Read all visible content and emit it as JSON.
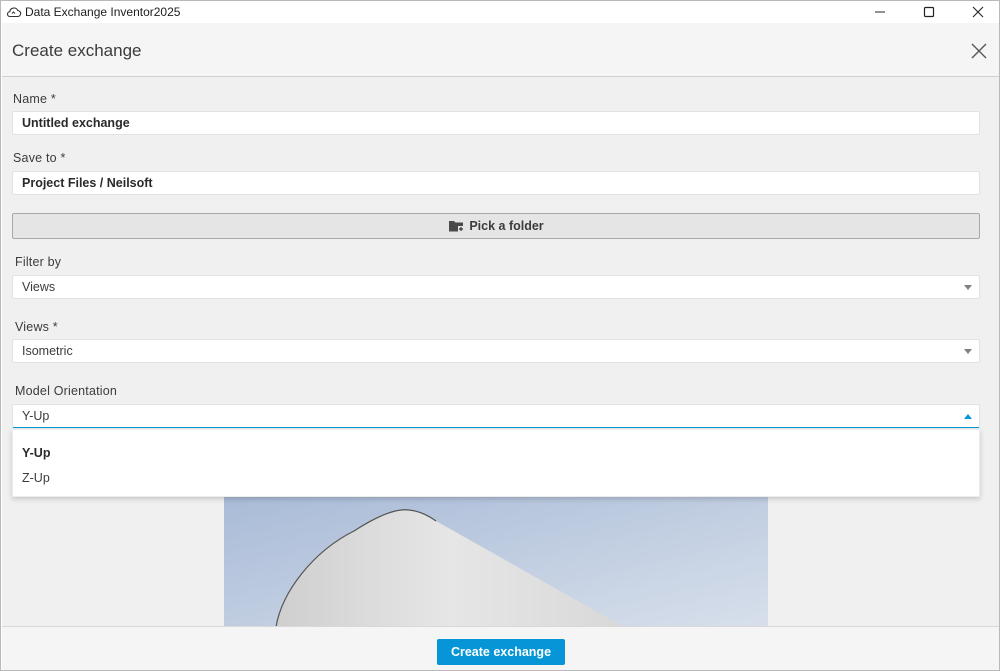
{
  "window": {
    "title": "Data Exchange Inventor2025"
  },
  "panel": {
    "title": "Create exchange"
  },
  "form": {
    "name_label": "Name *",
    "name_value": "Untitled exchange",
    "save_to_label": "Save to *",
    "save_to_value": "Project Files / Neilsoft",
    "pick_folder_label": "Pick a folder",
    "filter_by_label": "Filter by",
    "filter_by_value": "Views",
    "views_label": "Views *",
    "views_value": "Isometric",
    "orientation_label": "Model Orientation",
    "orientation_value": "Y-Up",
    "orientation_options": [
      "Y-Up",
      "Z-Up"
    ]
  },
  "footer": {
    "create_label": "Create exchange"
  },
  "colors": {
    "accent": "#0696d7",
    "panel_bg": "#f0f0f0",
    "preview_sky_top": "#a9bbd7",
    "preview_sky_bottom": "#d7dfeb"
  },
  "icons": {
    "app": "cloud-sync-icon",
    "folder": "folder-add-icon",
    "close": "close-icon"
  }
}
